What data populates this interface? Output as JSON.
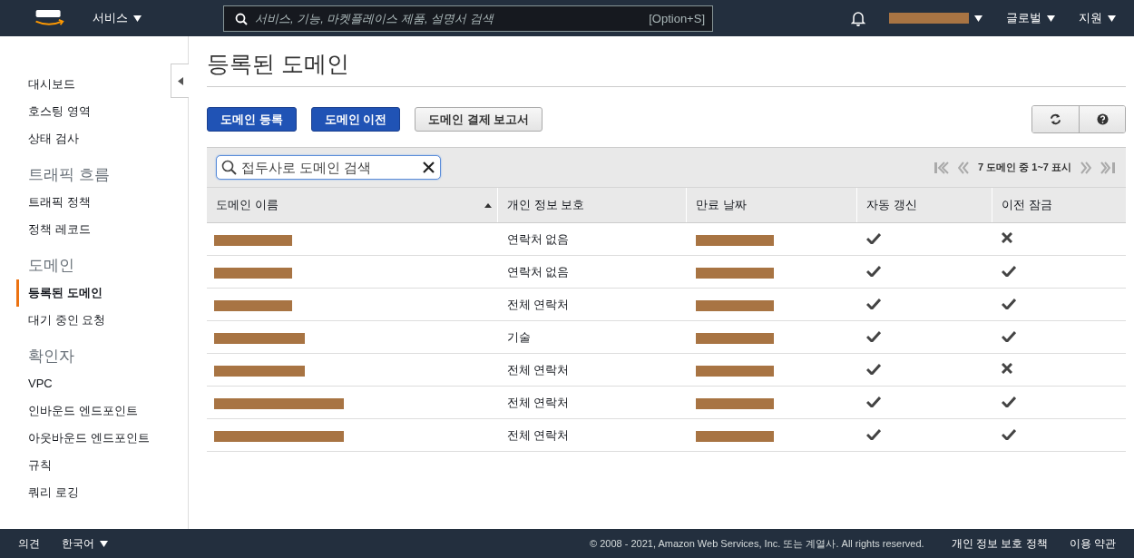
{
  "top_nav": {
    "services": "서비스",
    "search": {
      "placeholder": "서비스, 기능, 마켓플레이스 제품, 설명서 검색"
    },
    "shortcut": "[Option+S]",
    "region": "글로벌",
    "support": "지원"
  },
  "sidebar": {
    "sections": [
      {
        "items": [
          {
            "label": "대시보드",
            "selected": false
          },
          {
            "label": "호스팅 영역",
            "selected": false
          },
          {
            "label": "상태 검사",
            "selected": false
          }
        ]
      },
      {
        "heading": "트래픽 흐름",
        "items": [
          {
            "label": "트래픽 정책",
            "selected": false
          },
          {
            "label": "정책 레코드",
            "selected": false
          }
        ]
      },
      {
        "heading": "도메인",
        "items": [
          {
            "label": "등록된 도메인",
            "selected": true
          },
          {
            "label": "대기 중인 요청",
            "selected": false
          }
        ]
      },
      {
        "heading": "확인자",
        "items": [
          {
            "label": "VPC",
            "selected": false
          },
          {
            "label": "인바운드 엔드포인트",
            "selected": false
          },
          {
            "label": "아웃바운드 엔드포인트",
            "selected": false
          },
          {
            "label": "규칙",
            "selected": false
          },
          {
            "label": "쿼리 로깅",
            "selected": false
          }
        ]
      }
    ]
  },
  "page_title": "등록된 도메인",
  "buttons": [
    {
      "label": "도메인 등록",
      "kind": "primary"
    },
    {
      "label": "도메인 이전",
      "kind": "primary"
    },
    {
      "label": "도메인 결제 보고서",
      "kind": "secondary"
    }
  ],
  "filter": {
    "placeholder": "접두사로 도메인 검색"
  },
  "pagination": "7 도메인 중 1~7 표시",
  "table": {
    "columns": [
      "도메인 이름",
      "개인 정보 보호",
      "만료 날짜",
      "자동 갱신",
      "이전 잠금"
    ],
    "rows": [
      {
        "privacy": "연락처 없음",
        "auto_renew": true,
        "transfer_lock": false
      },
      {
        "privacy": "연락처 없음",
        "auto_renew": true,
        "transfer_lock": true
      },
      {
        "privacy": "전체 연락처",
        "auto_renew": true,
        "transfer_lock": true
      },
      {
        "privacy": "기술",
        "auto_renew": true,
        "transfer_lock": true
      },
      {
        "privacy": "전체 연락처",
        "auto_renew": true,
        "transfer_lock": false
      },
      {
        "privacy": "전체 연락처",
        "auto_renew": true,
        "transfer_lock": true
      },
      {
        "privacy": "전체 연락처",
        "auto_renew": true,
        "transfer_lock": true
      }
    ]
  },
  "footer": {
    "feedback": "의견",
    "language": "한국어",
    "copyright": "© 2008 - 2021, Amazon Web Services, Inc. 또는 계열사. All rights reserved.",
    "links": [
      "개인 정보 보호 정책",
      "이용 약관"
    ]
  }
}
